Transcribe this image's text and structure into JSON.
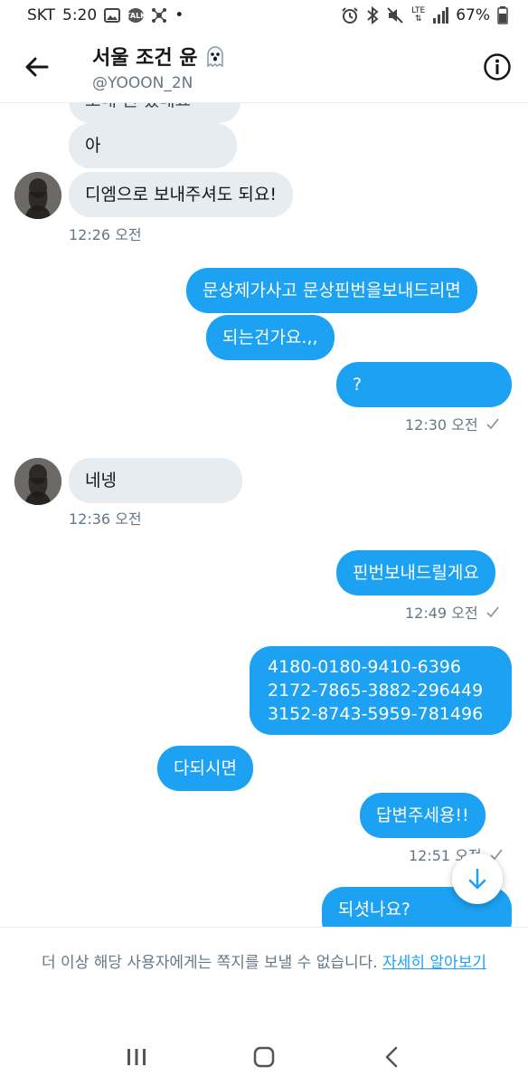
{
  "status_bar": {
    "carrier": "SKT",
    "time": "5:20",
    "talk_badge": "TALK",
    "dot": "•",
    "lte": "LTE",
    "battery": "67%"
  },
  "header": {
    "title": "서울 조건 윤",
    "handle": "@YOOON_2N"
  },
  "messages": {
    "partial_top": "보내 뭔 했네요",
    "m1": "아",
    "m2": "디엠으로 보내주셔도 되요!",
    "t1": "12:26 오전",
    "m3": "문상제가사고 문상핀번을보내드리면",
    "m4": "되는건가요.,,",
    "m5": "?",
    "t2": "12:30 오전",
    "m6": "네넹",
    "t3": "12:36 오전",
    "m7": "핀번보내드릴게요",
    "t4": "12:49 오전",
    "m8": "4180-0180-9410-6396\n2172-7865-3882-296449\n3152-8743-5959-781496",
    "m9": "다되시면",
    "m10": "답변주세용!!",
    "t5": "12:51 오전",
    "m11": "되셧나요?"
  },
  "footer": {
    "notice": "더 이상 해당 사용자에게는 쪽지를 보낼 수 없습니다.",
    "learn_more": "자세히 알아보기"
  },
  "colors": {
    "accent": "#1da1f2",
    "incoming_bubble": "#e6ecf0",
    "muted_text": "#657786"
  }
}
